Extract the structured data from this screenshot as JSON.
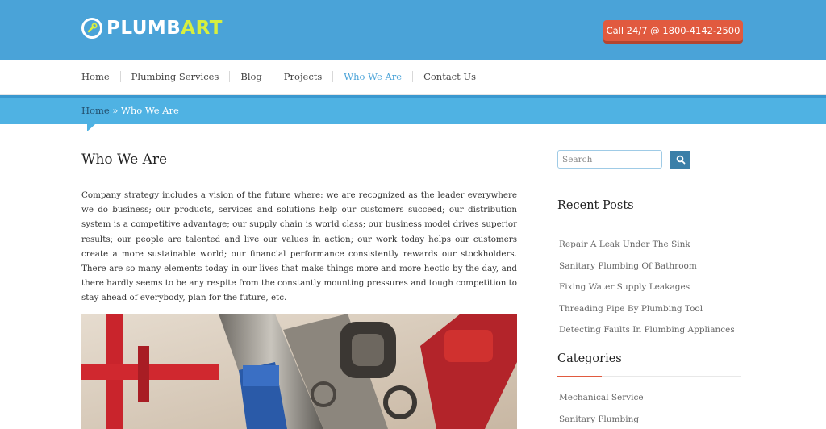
{
  "header": {
    "logo_part1": "PLUMB",
    "logo_part2": "ART",
    "call_label": "Call 24/7 @ 1800-4142-2500",
    "colors": {
      "bar": "#4aa3d8",
      "accent": "#d8ef3e",
      "call_button": "#e15a3f"
    }
  },
  "nav": {
    "items": [
      {
        "label": "Home",
        "active": false
      },
      {
        "label": "Plumbing Services",
        "active": false
      },
      {
        "label": "Blog",
        "active": false
      },
      {
        "label": "Projects",
        "active": false
      },
      {
        "label": "Who We Are",
        "active": true
      },
      {
        "label": "Contact Us",
        "active": false
      }
    ]
  },
  "breadcrumb": {
    "home": "Home",
    "separator": " » ",
    "current": "Who We Are"
  },
  "main": {
    "title": "Who We Are",
    "body": "Company strategy includes a vision of the future where: we are recognized as the leader everywhere we do business; our products, services and solutions help our customers succeed; our distribution system is a competitive advantage; our supply chain is world class; our business model drives superior results; our people are talented and live our values in action; our work today helps our customers create a more sustainable world; our financial performance consistently rewards our stockholders. There are so many elements today in our lives that make things more and more hectic by the day, and there hardly seems to be any respite from the constantly mounting pressures and tough competition to stay ahead of everybody, plan for the future, etc."
  },
  "sidebar": {
    "search_placeholder": "Search",
    "recent_posts": {
      "title": "Recent Posts",
      "items": [
        "Repair A Leak Under The Sink",
        "Sanitary Plumbing Of Bathroom",
        "Fixing Water Supply Leakages",
        "Threading Pipe By Plumbing Tool",
        "Detecting Faults In Plumbing Appliances"
      ]
    },
    "categories": {
      "title": "Categories",
      "items": [
        "Mechanical Service",
        "Sanitary Plumbing"
      ]
    }
  }
}
